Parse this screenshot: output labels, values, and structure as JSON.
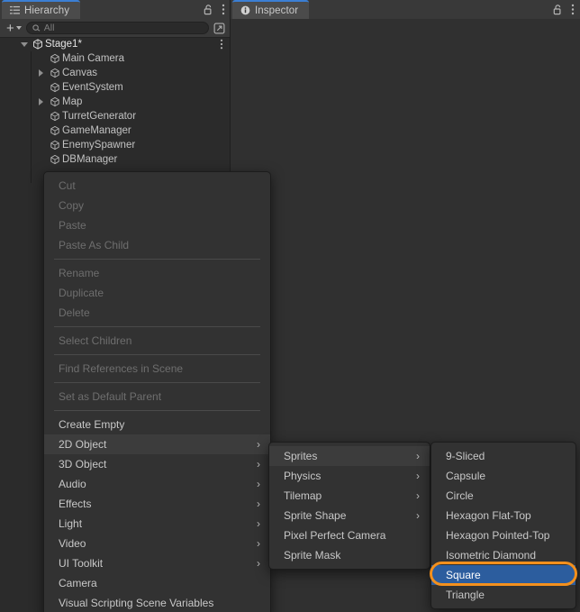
{
  "app": "Unity Editor",
  "panels": {
    "hierarchy": {
      "tab_label": "Hierarchy",
      "tab_icon": "hierarchy-icon",
      "lock_icon": "lock-open-icon",
      "menu_icon": "kebab-menu-icon",
      "toolbar": {
        "add_label": "+",
        "add_dropdown_icon": "chevron-down-icon",
        "search_icon": "search-icon",
        "search_placeholder": "All",
        "search_value": "",
        "expand_icon": "open-in-new-icon"
      },
      "tree": [
        {
          "label": "Stage1*",
          "depth": 0,
          "arrow": "open",
          "icon": "unity-scene-icon",
          "kebab": true
        },
        {
          "label": "Main Camera",
          "depth": 1,
          "arrow": "none",
          "icon": "gameobject-cube-icon"
        },
        {
          "label": "Canvas",
          "depth": 1,
          "arrow": "closed",
          "icon": "gameobject-cube-icon"
        },
        {
          "label": "EventSystem",
          "depth": 1,
          "arrow": "none",
          "icon": "gameobject-cube-icon"
        },
        {
          "label": "Map",
          "depth": 1,
          "arrow": "closed",
          "icon": "gameobject-cube-icon"
        },
        {
          "label": "TurretGenerator",
          "depth": 1,
          "arrow": "none",
          "icon": "gameobject-cube-icon"
        },
        {
          "label": "GameManager",
          "depth": 1,
          "arrow": "none",
          "icon": "gameobject-cube-icon"
        },
        {
          "label": "EnemySpawner",
          "depth": 1,
          "arrow": "none",
          "icon": "gameobject-cube-icon"
        },
        {
          "label": "DBManager",
          "depth": 1,
          "arrow": "none",
          "icon": "gameobject-cube-icon"
        }
      ]
    },
    "inspector": {
      "tab_label": "Inspector",
      "tab_icon": "info-icon",
      "lock_icon": "lock-open-icon",
      "menu_icon": "kebab-menu-icon"
    }
  },
  "context_menu": {
    "items": [
      {
        "label": "Cut",
        "state": "disabled"
      },
      {
        "label": "Copy",
        "state": "disabled"
      },
      {
        "label": "Paste",
        "state": "disabled"
      },
      {
        "label": "Paste As Child",
        "state": "disabled"
      },
      {
        "separator": true
      },
      {
        "label": "Rename",
        "state": "disabled"
      },
      {
        "label": "Duplicate",
        "state": "disabled"
      },
      {
        "label": "Delete",
        "state": "disabled"
      },
      {
        "separator": true
      },
      {
        "label": "Select Children",
        "state": "disabled"
      },
      {
        "separator": true
      },
      {
        "label": "Find References in Scene",
        "state": "disabled"
      },
      {
        "separator": true
      },
      {
        "label": "Set as Default Parent",
        "state": "disabled"
      },
      {
        "separator": true
      },
      {
        "label": "Create Empty",
        "state": "normal"
      },
      {
        "label": "2D Object",
        "state": "highlighted",
        "submenu": true
      },
      {
        "label": "3D Object",
        "state": "normal",
        "submenu": true
      },
      {
        "label": "Audio",
        "state": "normal",
        "submenu": true
      },
      {
        "label": "Effects",
        "state": "normal",
        "submenu": true
      },
      {
        "label": "Light",
        "state": "normal",
        "submenu": true
      },
      {
        "label": "Video",
        "state": "normal",
        "submenu": true
      },
      {
        "label": "UI Toolkit",
        "state": "normal",
        "submenu": true
      },
      {
        "label": "Camera",
        "state": "normal"
      },
      {
        "label": "Visual Scripting Scene Variables",
        "state": "normal",
        "clipped": true
      }
    ]
  },
  "submenu_2d_object": {
    "items": [
      {
        "label": "Sprites",
        "state": "highlighted",
        "submenu": true
      },
      {
        "label": "Physics",
        "state": "normal",
        "submenu": true
      },
      {
        "label": "Tilemap",
        "state": "normal",
        "submenu": true
      },
      {
        "label": "Sprite Shape",
        "state": "normal",
        "submenu": true
      },
      {
        "label": "Pixel Perfect Camera",
        "state": "normal"
      },
      {
        "label": "Sprite Mask",
        "state": "normal"
      }
    ]
  },
  "submenu_sprites": {
    "items": [
      {
        "label": "9-Sliced",
        "state": "normal"
      },
      {
        "label": "Capsule",
        "state": "normal"
      },
      {
        "label": "Circle",
        "state": "normal"
      },
      {
        "label": "Hexagon Flat-Top",
        "state": "normal"
      },
      {
        "label": "Hexagon Pointed-Top",
        "state": "normal"
      },
      {
        "label": "Isometric Diamond",
        "state": "normal"
      },
      {
        "label": "Square",
        "state": "selected"
      },
      {
        "label": "Triangle",
        "state": "normal"
      }
    ],
    "annotation": {
      "target": "Square",
      "highlight_color": "#f3901d",
      "shape": "rounded-rect-outline"
    }
  },
  "colors": {
    "panel_bg": "#2b2b2b",
    "inspector_bg": "#303030",
    "toolbar_bg": "#393939",
    "tab_active_bg": "#4b4b4b",
    "tab_accent": "#3b7fd4",
    "menu_bg": "#323232",
    "menu_hover": "#3c3c3c",
    "selection_blue": "#2c5d9e",
    "annotation_orange": "#f3901d",
    "text_primary": "#c8c8c8",
    "text_disabled": "#6e6e6e"
  }
}
